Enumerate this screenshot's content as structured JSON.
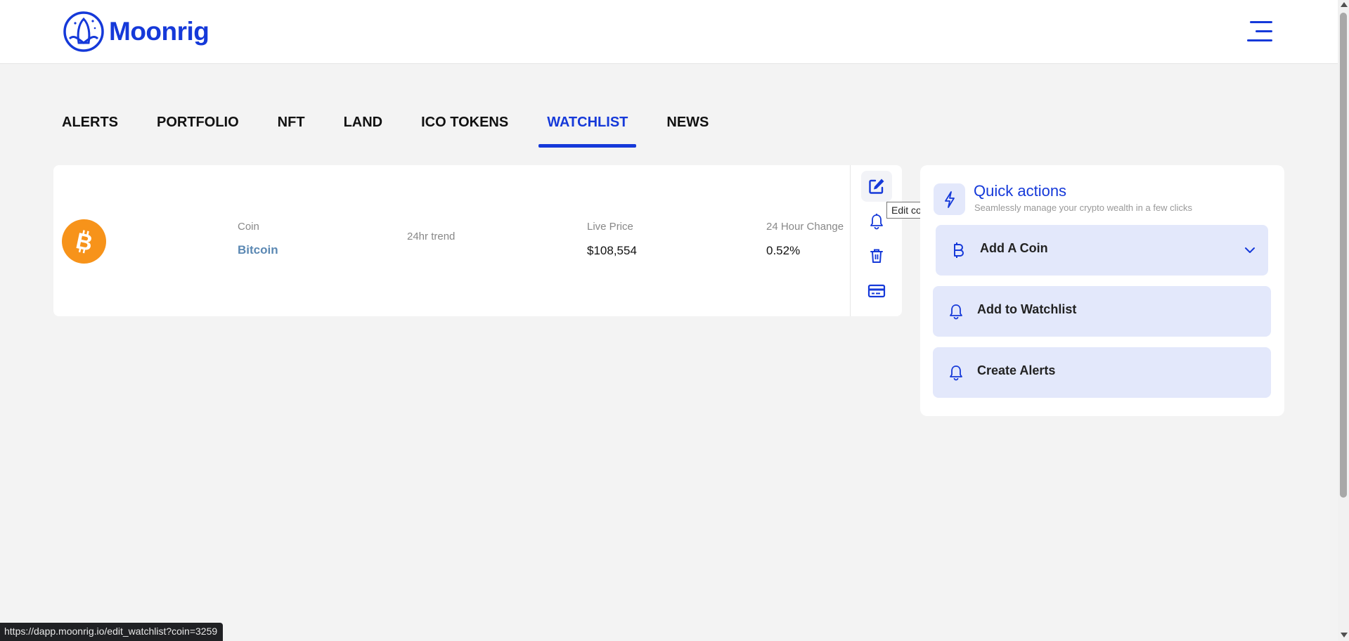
{
  "brand": {
    "name": "Moonrig",
    "color": "#1539d9"
  },
  "header": {
    "menu_icon": "hamburger-menu-icon"
  },
  "tabs": [
    {
      "label": "ALERTS",
      "active": false
    },
    {
      "label": "PORTFOLIO",
      "active": false
    },
    {
      "label": "NFT",
      "active": false
    },
    {
      "label": "LAND",
      "active": false
    },
    {
      "label": "ICO TOKENS",
      "active": false
    },
    {
      "label": "WATCHLIST",
      "active": true
    },
    {
      "label": "NEWS",
      "active": false
    }
  ],
  "watchlist": {
    "columns": {
      "coin": "Coin",
      "trend": "24hr trend",
      "price": "Live Price",
      "change": "24 Hour Change"
    },
    "rows": [
      {
        "icon": "bitcoin-icon",
        "name": "Bitcoin",
        "price": "$108,554",
        "change": "0.52%"
      }
    ],
    "row_actions": [
      "edit-icon",
      "bell-icon",
      "trash-icon",
      "card-icon"
    ],
    "tooltip": "Edit coin"
  },
  "quick_actions": {
    "icon": "lightning-icon",
    "title": "Quick actions",
    "subtitle": "Seamlessly manage your crypto wealth in a few clicks",
    "items": [
      {
        "label": "Add A Coin",
        "icon": "bitcoin-icon",
        "dropdown": true
      },
      {
        "label": "Add to Watchlist",
        "icon": "bell-icon"
      },
      {
        "label": "Create Alerts",
        "icon": "bell-icon"
      }
    ],
    "item_background": "#e3e8fb"
  },
  "status_bar": {
    "url": "https://dapp.moonrig.io/edit_watchlist?coin=3259"
  }
}
